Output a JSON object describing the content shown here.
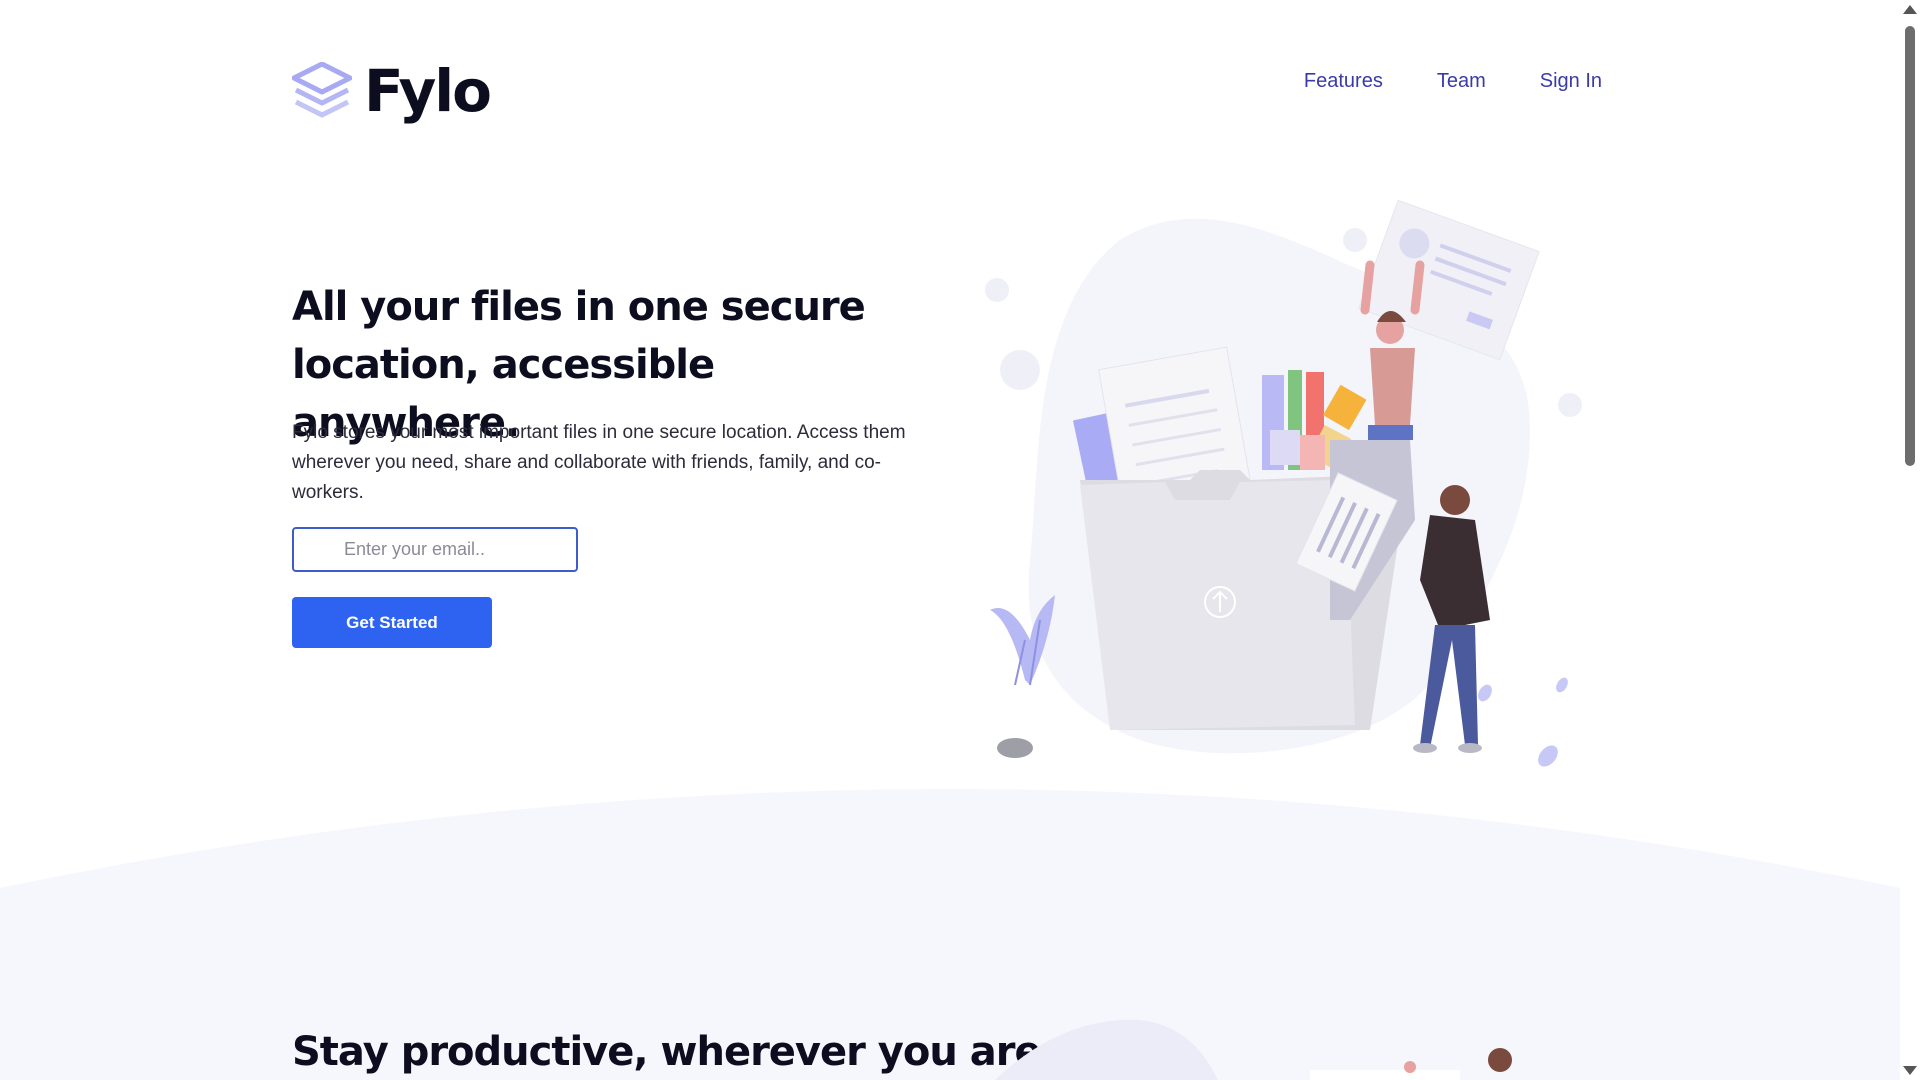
{
  "header": {
    "logo_text": "Fylo",
    "nav": [
      {
        "label": "Features"
      },
      {
        "label": "Team"
      },
      {
        "label": "Sign In"
      }
    ]
  },
  "hero": {
    "title": "All your files in one secure location, accessible anywhere.",
    "description": "Fylo stores your most important files in one secure location. Access them wherever you need, share and collaborate with friends, family, and co-workers.",
    "email_placeholder": "Enter your email..",
    "cta_label": "Get Started"
  },
  "section2": {
    "title": "Stay productive, wherever you are"
  },
  "colors": {
    "accent": "#2e63f2",
    "heading": "#0c0d1e",
    "nav_link": "#3b3ba8",
    "input_border": "#3f5ccc",
    "wave_bg": "#f6f6fd",
    "logo_icon": "#a7a9f2"
  },
  "icons": {
    "logo": "stacked-layers-icon",
    "upload": "upload-arrow-icon"
  }
}
